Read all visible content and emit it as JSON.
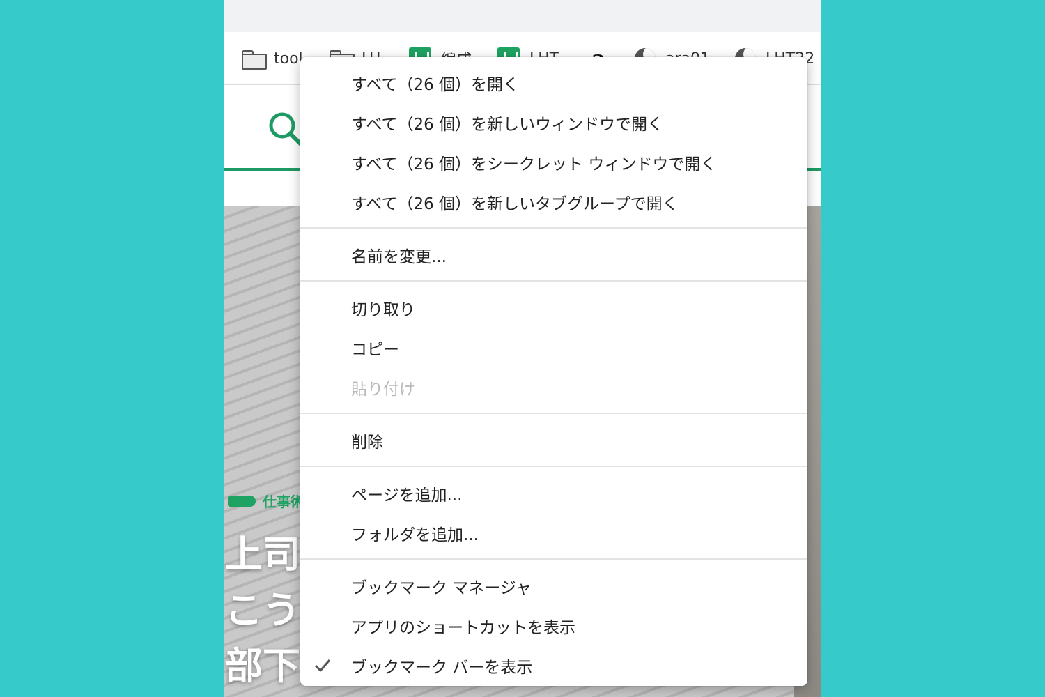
{
  "bookmarks_bar": {
    "items": [
      {
        "label": "tool",
        "icon": "folder-icon"
      },
      {
        "label": "LU",
        "icon": "folder-icon"
      },
      {
        "label": "編成",
        "icon": "green-sheet-icon"
      },
      {
        "label": "LHT",
        "icon": "green-sheet-icon"
      },
      {
        "label": "a",
        "icon": "amazon-icon"
      },
      {
        "label": "ara01",
        "icon": "moon-icon"
      },
      {
        "label": "LHT22",
        "icon": "moon-icon"
      }
    ]
  },
  "site_header": {
    "search_icon": "search-icon",
    "accent_color": "#1E9A64"
  },
  "hero": {
    "category": "仕事術",
    "lines": [
      "上司",
      "こう",
      "部下"
    ]
  },
  "context_menu": {
    "groups": [
      [
        {
          "label": "すべて（26 個）を開く"
        },
        {
          "label": "すべて（26 個）を新しいウィンドウで開く"
        },
        {
          "label": "すべて（26 個）をシークレット ウィンドウで開く"
        },
        {
          "label": "すべて（26 個）を新しいタブグループで開く"
        }
      ],
      [
        {
          "label": "名前を変更..."
        }
      ],
      [
        {
          "label": "切り取り"
        },
        {
          "label": "コピー"
        },
        {
          "label": "貼り付け",
          "disabled": true
        }
      ],
      [
        {
          "label": "削除"
        }
      ],
      [
        {
          "label": "ページを追加..."
        },
        {
          "label": "フォルダを追加..."
        }
      ],
      [
        {
          "label": "ブックマーク マネージャ"
        },
        {
          "label": "アプリのショートカットを表示"
        },
        {
          "label": "ブックマーク バーを表示",
          "checked": true
        }
      ]
    ]
  },
  "colors": {
    "background": "#36CACB",
    "brand_green": "#1EA362"
  }
}
